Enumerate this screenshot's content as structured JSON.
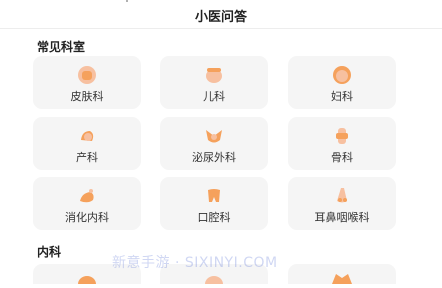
{
  "header": {
    "title": "小医问答"
  },
  "sections": [
    {
      "title": "常见科室",
      "items": [
        {
          "label": "皮肤科",
          "icon": "hand-skin-icon"
        },
        {
          "label": "儿科",
          "icon": "baby-face-icon"
        },
        {
          "label": "妇科",
          "icon": "woman-face-icon"
        },
        {
          "label": "产科",
          "icon": "pregnancy-icon"
        },
        {
          "label": "泌尿外科",
          "icon": "kidney-icon"
        },
        {
          "label": "骨科",
          "icon": "bone-icon"
        },
        {
          "label": "消化内科",
          "icon": "stomach-icon"
        },
        {
          "label": "口腔科",
          "icon": "tooth-icon"
        },
        {
          "label": "耳鼻咽喉科",
          "icon": "nose-icon"
        }
      ]
    },
    {
      "title": "内科"
    }
  ],
  "watermark": "新意手游 · SIXINYI.COM",
  "colors": {
    "icon_orange": "#f5a15c",
    "icon_pink": "#f7c0a0",
    "card_bg": "#f5f5f5"
  }
}
